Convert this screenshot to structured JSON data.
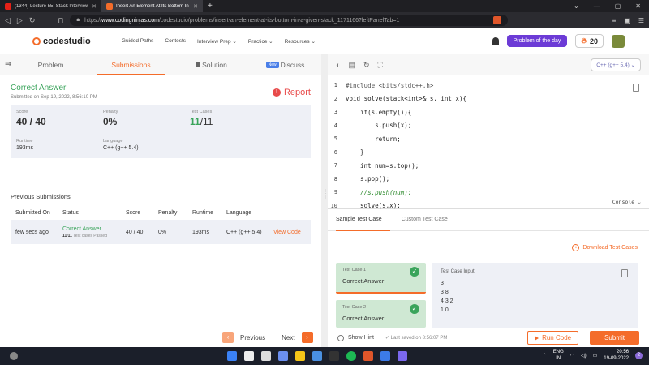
{
  "browser": {
    "tabs": [
      {
        "title": "(1344) Lecture 55: Stack Interview Qu",
        "favicon_color": "#e62117",
        "active": false
      },
      {
        "title": "Insert An Element At Its Bottom In",
        "favicon_color": "#f46c2a",
        "active": true
      }
    ],
    "new_tab_symbol": "+",
    "url_prefix": "https://",
    "url_host": "www.codingninjas.com",
    "url_path": "/codestudio/problems/insert-an-element-at-its-bottom-in-a-given-stack_1171166?leftPanelTab=1"
  },
  "site": {
    "logo_text": "codestudio",
    "nav": [
      "Guided Paths",
      "Contests",
      "Interview Prep ⌄",
      "Practice ⌄",
      "Resources ⌄"
    ],
    "problem_of_day": "Problem of the day",
    "streak": "20"
  },
  "left": {
    "tabs": {
      "problem": "Problem",
      "submissions": "Submissions",
      "solution": "Solution",
      "discuss": "Discuss",
      "new_badge": "New"
    },
    "result": {
      "status": "Correct Answer",
      "submitted_on": "Submitted on Sep 19, 2022, 8:56:10 PM",
      "report": "Report"
    },
    "stats": {
      "score_label": "Score",
      "score": "40 / 40",
      "penalty_label": "Penalty",
      "penalty": "0%",
      "testcases_label": "Test Cases",
      "testcases_passed": "11",
      "testcases_total": "/11",
      "runtime_label": "Runtime",
      "runtime": "193ms",
      "language_label": "Language",
      "language": "C++ (g++ 5.4)"
    },
    "previous": {
      "title": "Previous Submissions",
      "headers": [
        "Submitted On",
        "Status",
        "Score",
        "Penalty",
        "Runtime",
        "Language",
        ""
      ],
      "row": {
        "submitted_on": "few secs ago",
        "status": "Correct Answer",
        "passed_count": "11/11",
        "passed_text": "Test cases Passed",
        "score": "40 / 40",
        "penalty": "0%",
        "runtime": "193ms",
        "language": "C++ (g++ 5.4)",
        "action": "View Code"
      }
    },
    "pager": {
      "previous": "Previous",
      "next": "Next"
    }
  },
  "editor": {
    "language": "C++ (g++ 5.4) ⌄",
    "lines": [
      {
        "n": "1",
        "html": "<span class=\"inc\">#include &lt;bits/stdc++.h&gt;</span>"
      },
      {
        "n": "2",
        "html": "void solve(stack&lt;int&gt;&amp; s, int x){"
      },
      {
        "n": "3",
        "html": "    if(s.empty()){"
      },
      {
        "n": "4",
        "html": "        s.push(x);"
      },
      {
        "n": "5",
        "html": "        return;"
      },
      {
        "n": "6",
        "html": "    }"
      },
      {
        "n": "7",
        "html": "    int num=s.top();"
      },
      {
        "n": "8",
        "html": "    s.pop();"
      },
      {
        "n": "9",
        "html": "    <span class=\"cm\">//s.push(num);</span>"
      },
      {
        "n": "10",
        "html": "    solve(s,x);"
      }
    ],
    "console": "Console ⌄"
  },
  "testcases": {
    "tabs": {
      "sample": "Sample Test Case",
      "custom": "Custom Test Case"
    },
    "download": "Download Test Cases",
    "cases": [
      {
        "label": "Test Case 1",
        "result": "Correct Answer"
      },
      {
        "label": "Test Case 2",
        "result": "Correct Answer"
      }
    ],
    "input_label": "Test Case Input",
    "input_lines": [
      "3",
      "3 8",
      "4 3 2",
      "1 0",
      "1"
    ]
  },
  "bottom": {
    "hint": "Show Hint",
    "saved": "Last saved on 8:56:07 PM",
    "run": "Run Code",
    "submit": "Submit"
  },
  "taskbar": {
    "lang1": "ENG",
    "lang2": "IN",
    "time": "20:56",
    "date": "19-09-2022",
    "notifications": "2",
    "icon_colors": [
      "#3b82f6",
      "#eeeeee",
      "#dddddd",
      "#6b8ff0",
      "#f5c518",
      "#4a90e2",
      "#333333",
      "#1db954",
      "#e0562a",
      "#3c7be8",
      "#7b68ee"
    ]
  },
  "colors": {
    "accent": "#f46c2a",
    "success": "#3aa45b",
    "purple": "#6c3bd6",
    "danger": "#e84b4b"
  }
}
